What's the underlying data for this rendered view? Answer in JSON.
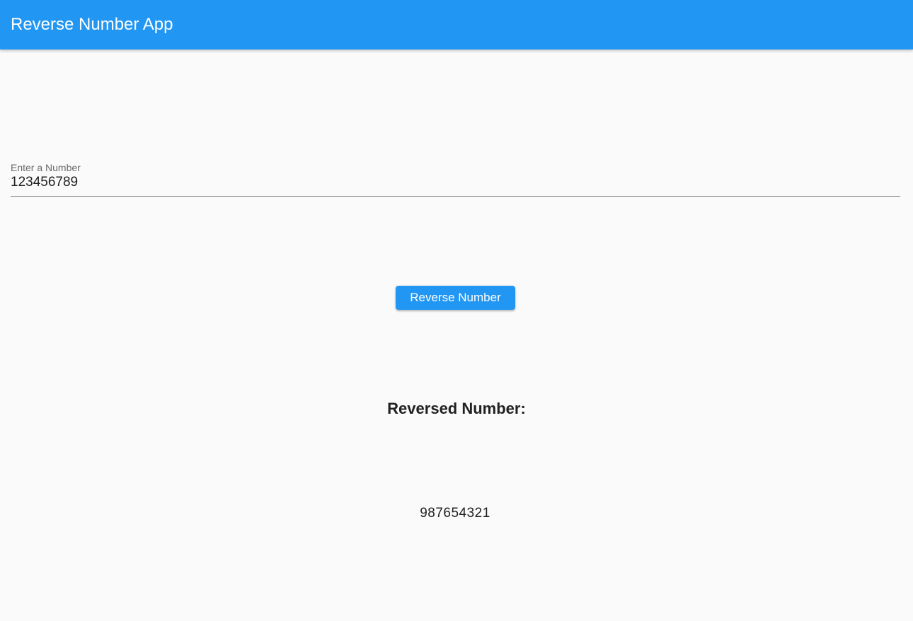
{
  "app_bar": {
    "title": "Reverse Number App",
    "color": "#2196f3"
  },
  "number_field": {
    "label": "Enter a Number",
    "value": "123456789"
  },
  "reverse_button": {
    "label": "Reverse Number",
    "color": "#2196f3"
  },
  "result": {
    "heading": "Reversed Number:",
    "value": "987654321"
  }
}
